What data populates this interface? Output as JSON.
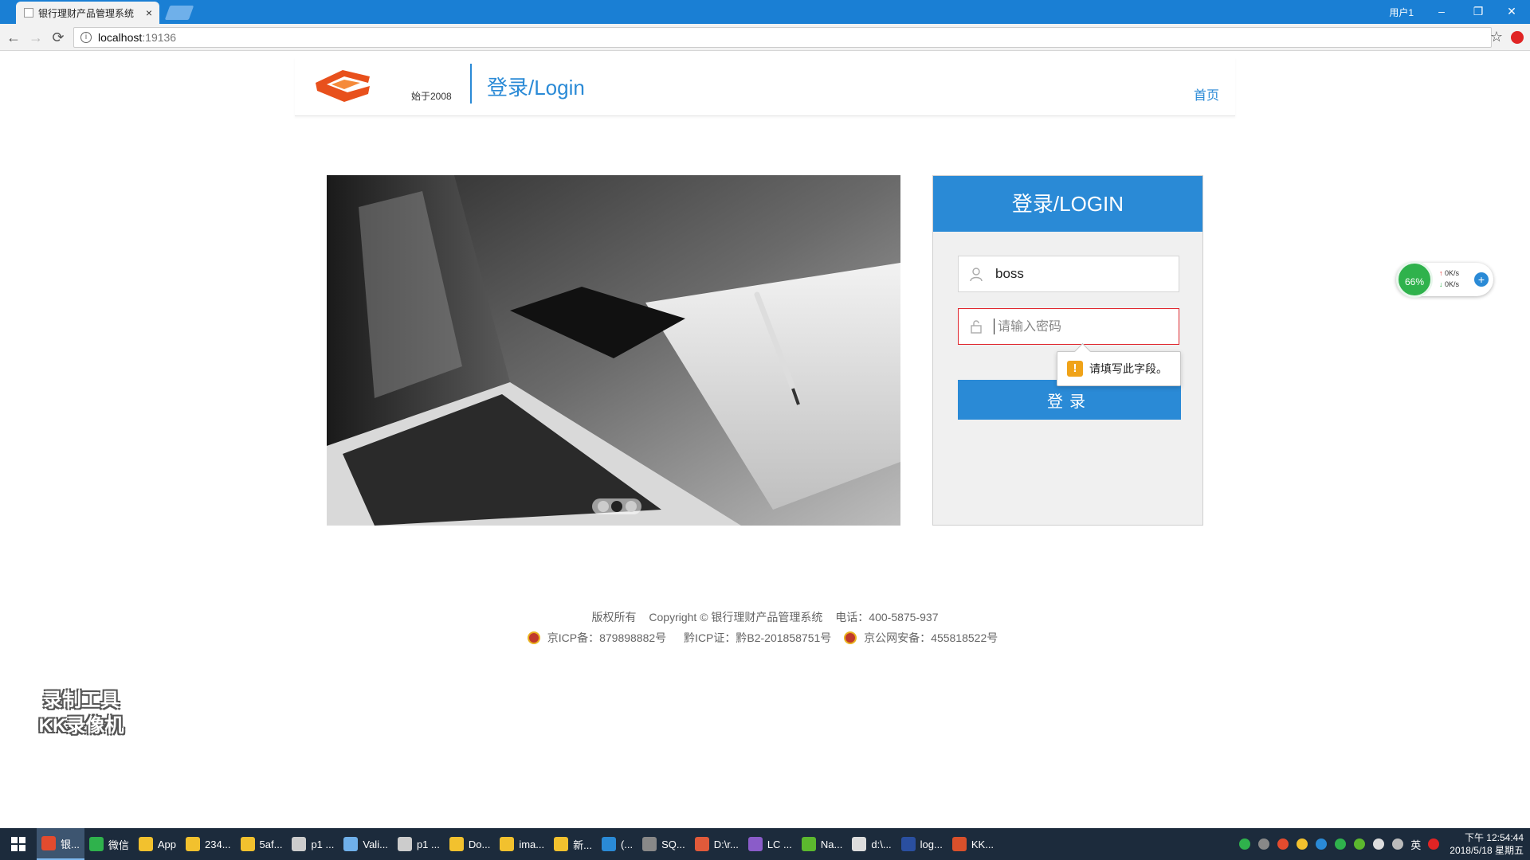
{
  "browser": {
    "tab_title": "银行理财产品管理系统",
    "tab_close": "×",
    "user_label": "用户1",
    "window_controls": {
      "minimize": "–",
      "restore": "❐",
      "close": "✕"
    },
    "nav": {
      "back": "←",
      "forward": "→",
      "reload": "⟳"
    },
    "url_host": "localhost",
    "url_port": ":19136",
    "info_icon": "i",
    "star_icon": "☆"
  },
  "header": {
    "since": "始于2008",
    "title": "登录/Login",
    "home_link": "首页",
    "brand_color": "#2a8ad6"
  },
  "carousel": {
    "slide_count": 3,
    "active_index": 1
  },
  "login": {
    "heading": "登录/LOGIN",
    "username_value": "boss",
    "password_placeholder": "请输入密码",
    "validation_icon": "!",
    "validation_message": "请填写此字段。",
    "submit_label": "登录"
  },
  "footer": {
    "rights": "版权所有",
    "copyright": "Copyright © 银行理财产品管理系统",
    "phone": "电话：400-5875-937",
    "icp_record": "京ICP备：879898882号",
    "icp_cert": "黔ICP证：黔B2-201858751号",
    "police_record": "京公网安备：455818522号"
  },
  "watermark": {
    "line1": "录制工具",
    "line2": "KK录像机"
  },
  "net_widget": {
    "percent": "66%",
    "up_rate": "0K/s",
    "down_rate": "0K/s",
    "up_arrow": "↑",
    "down_arrow": "↓",
    "plus": "+"
  },
  "taskbar": {
    "items": [
      {
        "label": "银...",
        "color": "#e34b2e"
      },
      {
        "label": "微信",
        "color": "#2fb24c"
      },
      {
        "label": "App",
        "color": "#f2c12e"
      },
      {
        "label": "234...",
        "color": "#f2c12e"
      },
      {
        "label": "5af...",
        "color": "#f2c12e"
      },
      {
        "label": "p1 ...",
        "color": "#cccccc"
      },
      {
        "label": "Vali...",
        "color": "#6fb0ea"
      },
      {
        "label": "p1 ...",
        "color": "#cccccc"
      },
      {
        "label": "Do...",
        "color": "#f2c12e"
      },
      {
        "label": "ima...",
        "color": "#f2c12e"
      },
      {
        "label": "新...",
        "color": "#f2c12e"
      },
      {
        "label": "(...",
        "color": "#2a8ad6"
      },
      {
        "label": "SQ...",
        "color": "#888888"
      },
      {
        "label": "D:\\r...",
        "color": "#e05a3a"
      },
      {
        "label": "LC ...",
        "color": "#8a5cc9"
      },
      {
        "label": "Na...",
        "color": "#5cb82e"
      },
      {
        "label": "d:\\...",
        "color": "#dddddd"
      },
      {
        "label": "log...",
        "color": "#2a4fa0"
      },
      {
        "label": "KK...",
        "color": "#d9502b"
      }
    ],
    "tray_lang": "英",
    "clock_time": "下午 12:54:44",
    "clock_date": "2018/5/18 星期五"
  }
}
